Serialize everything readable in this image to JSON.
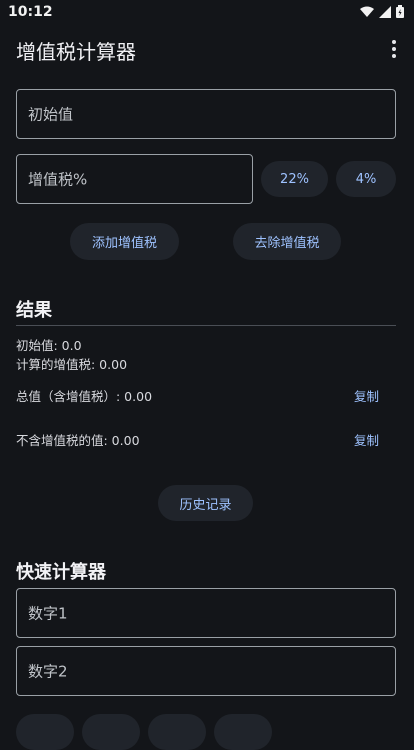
{
  "status": {
    "time": "10:12"
  },
  "appbar": {
    "title": "增值税计算器"
  },
  "inputs": {
    "initial_placeholder": "初始值",
    "vat_placeholder": "增值税%"
  },
  "vat_presets": [
    "22%",
    "4%"
  ],
  "actions": {
    "add_vat": "添加增值税",
    "remove_vat": "去除增值税"
  },
  "results": {
    "title": "结果",
    "initial_value": "初始值: 0.0",
    "calculated_vat": "计算的增值税: 0.00",
    "total_incl_vat": "总值（含增值税）: 0.00",
    "value_excl_vat": "不含增值税的值: 0.00",
    "copy_label": "复制"
  },
  "history_label": "历史记录",
  "quick_calc": {
    "title": "快速计算器",
    "number1_placeholder": "数字1",
    "number2_placeholder": "数字2"
  }
}
